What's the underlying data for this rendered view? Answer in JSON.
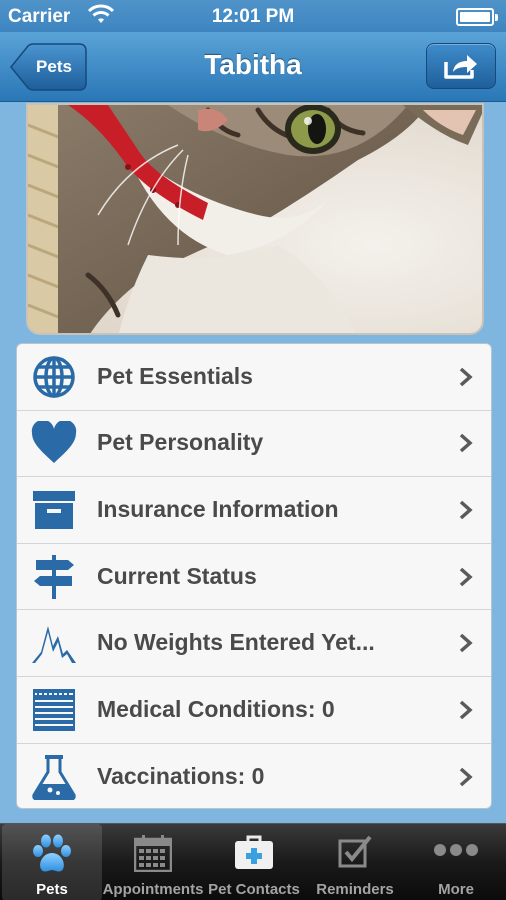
{
  "status_bar": {
    "carrier": "Carrier",
    "time": "12:01 PM"
  },
  "nav": {
    "title": "Tabitha",
    "back_label": "Pets",
    "share_icon": "share-icon"
  },
  "photo": {
    "description": "cat-photo"
  },
  "menu": {
    "items": [
      {
        "label": "Pet Essentials",
        "icon": "globe-icon"
      },
      {
        "label": "Pet Personality",
        "icon": "heart-icon"
      },
      {
        "label": "Insurance Information",
        "icon": "file-box-icon"
      },
      {
        "label": "Current Status",
        "icon": "signpost-icon"
      },
      {
        "label": "No Weights Entered Yet...",
        "icon": "weight-graph-icon"
      },
      {
        "label": "Medical Conditions: 0",
        "icon": "notepad-icon"
      },
      {
        "label": "Vaccinations: 0",
        "icon": "flask-icon"
      }
    ]
  },
  "tabs": [
    {
      "label": "Pets",
      "icon": "paw-icon",
      "active": true
    },
    {
      "label": "Appointments",
      "icon": "calendar-icon",
      "active": false
    },
    {
      "label": "Pet Contacts",
      "icon": "first-aid-kit-icon",
      "active": false
    },
    {
      "label": "Reminders",
      "icon": "checkbox-icon",
      "active": false
    },
    {
      "label": "More",
      "icon": "more-dots-icon",
      "active": false
    }
  ],
  "colors": {
    "accent": "#2a6aa6",
    "nav_bar": "#3e85c0",
    "tab_bar": "#1a1a1a",
    "background": "#7fb6e0"
  }
}
